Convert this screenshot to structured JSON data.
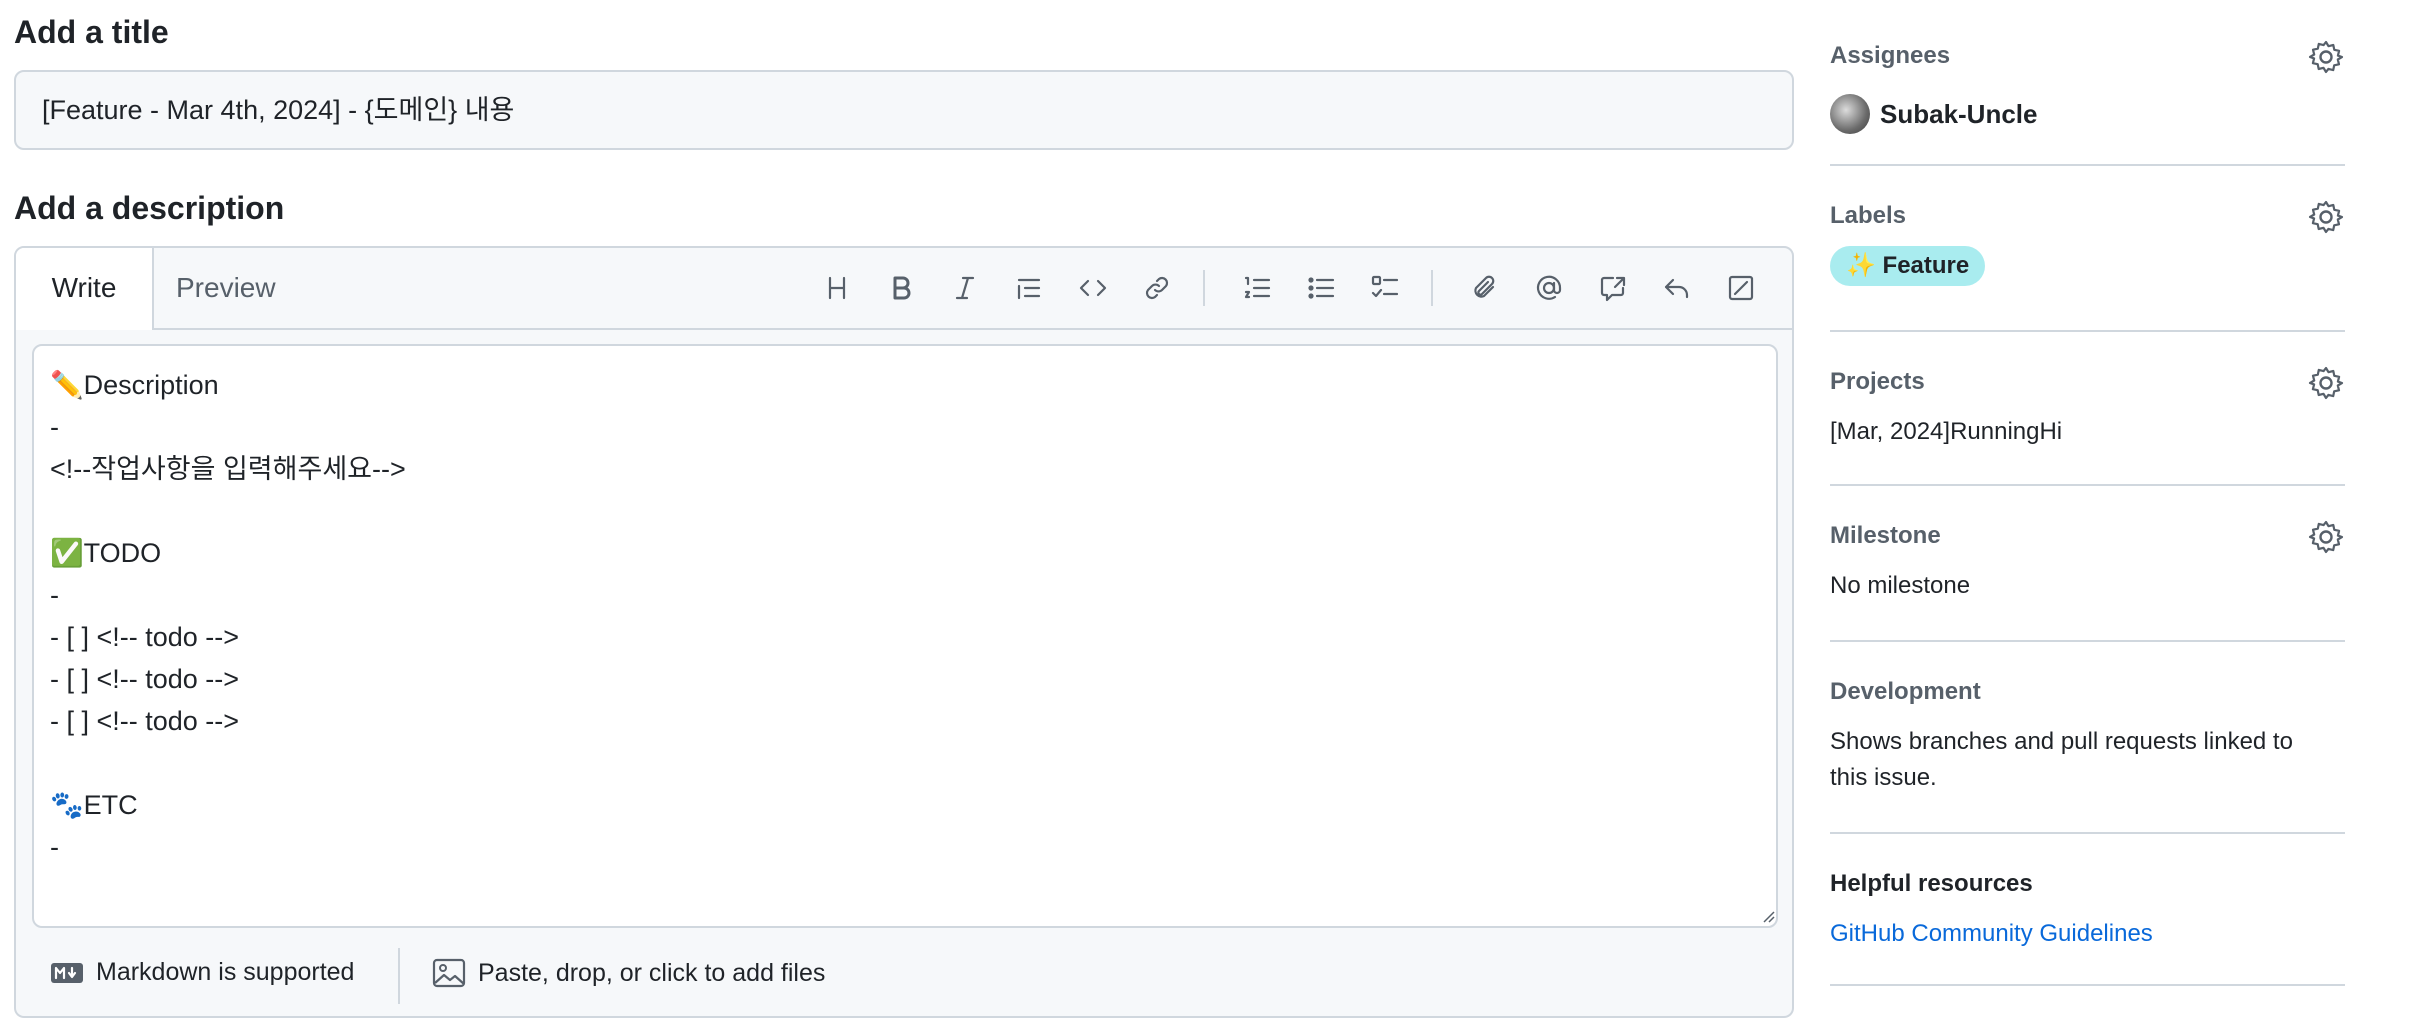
{
  "main": {
    "title_heading": "Add a title",
    "title_value": "[Feature - Mar 4th, 2024] - {도메인} 내용",
    "description_heading": "Add a description",
    "tabs": [
      {
        "label": "Write",
        "active": true
      },
      {
        "label": "Preview",
        "active": false
      }
    ],
    "toolbar_icons": [
      "heading-icon",
      "bold-icon",
      "italic-icon",
      "quote-icon",
      "code-icon",
      "link-icon",
      "numbered-list-icon",
      "bulleted-list-icon",
      "task-list-icon",
      "attach-icon",
      "mention-icon",
      "cross-reference-icon",
      "reply-icon",
      "fullscreen-icon"
    ],
    "description_text": "✏️Description\n-\n<!--작업사항을 입력해주세요-->\n\n✅TODO\n-\n- [ ] <!-- todo -->\n- [ ] <!-- todo -->\n- [ ] <!-- todo -->\n\n🐾ETC\n-",
    "footer": {
      "markdown_label": "Markdown is supported",
      "attach_label": "Paste, drop, or click to add files"
    }
  },
  "sidebar": {
    "assignees": {
      "heading": "Assignees",
      "user": "Subak-Uncle"
    },
    "labels": {
      "heading": "Labels",
      "label": "✨ Feature",
      "color": "#a9ecef"
    },
    "projects": {
      "heading": "Projects",
      "value": "[Mar, 2024]RunningHi"
    },
    "milestone": {
      "heading": "Milestone",
      "value": "No milestone"
    },
    "development": {
      "heading": "Development",
      "value": "Shows branches and pull requests linked to this issue."
    },
    "resources": {
      "heading": "Helpful resources",
      "link": "GitHub Community Guidelines"
    }
  },
  "colors": {
    "border": "#d0d7de",
    "link": "#0969da",
    "muted": "#57606a"
  }
}
